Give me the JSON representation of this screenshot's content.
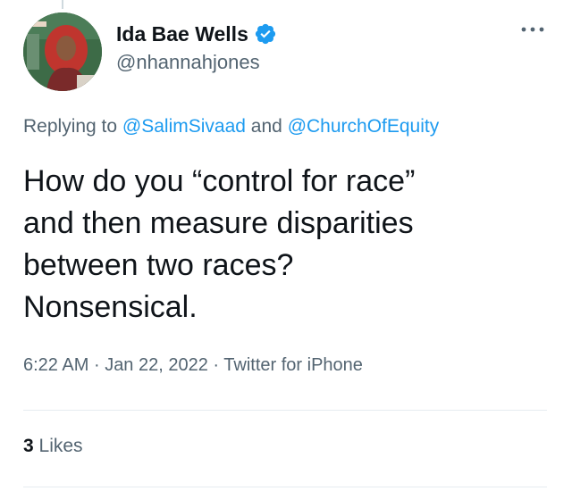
{
  "tweet": {
    "author": {
      "display_name": "Ida Bae Wells",
      "handle": "@nhannahjones",
      "verified": true,
      "avatar_icon": "profile-photo"
    },
    "reply": {
      "prefix": "Replying to",
      "mention_1": "@SalimSivaad",
      "conjunction": "and",
      "mention_2": "@ChurchOfEquity"
    },
    "text_lines": [
      "How do you “control for race”",
      "and then measure disparities",
      "between two races?",
      "Nonsensical."
    ],
    "meta": {
      "time": "6:22 AM",
      "separator_1": "·",
      "date": "Jan 22, 2022",
      "separator_2": "·",
      "source": "Twitter for iPhone"
    },
    "stats": {
      "likes_count": "3",
      "likes_label": "Likes"
    },
    "more_icon": "more-icon"
  },
  "colors": {
    "text_primary": "#0f1419",
    "text_secondary": "#536471",
    "accent": "#1d9bf0",
    "divider": "#e6ecf0"
  }
}
